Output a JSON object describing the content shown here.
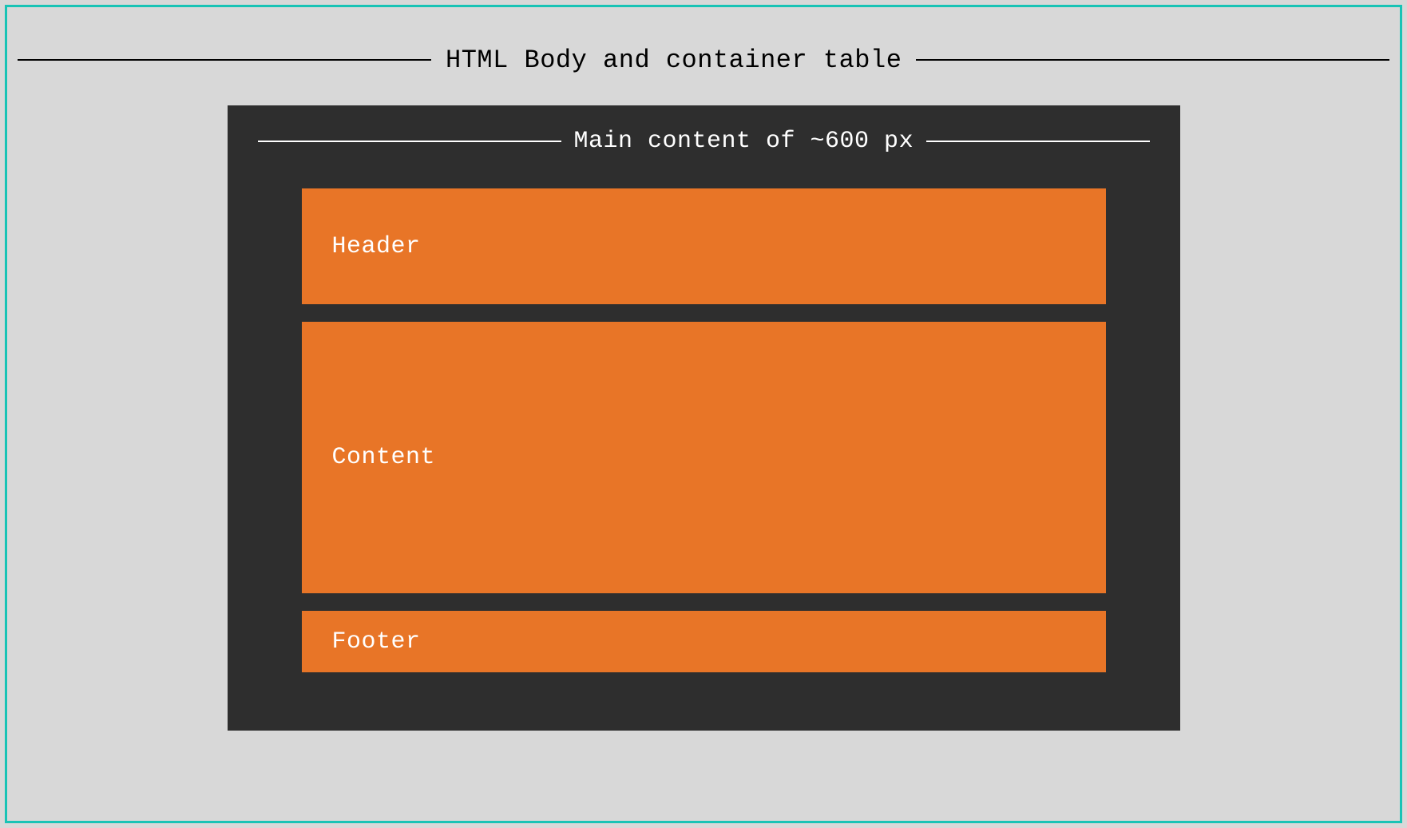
{
  "outer": {
    "title": "HTML Body and container table"
  },
  "inner": {
    "title": "Main content of ~600 px",
    "blocks": {
      "header": "Header",
      "content": "Content",
      "footer": "Footer"
    }
  }
}
